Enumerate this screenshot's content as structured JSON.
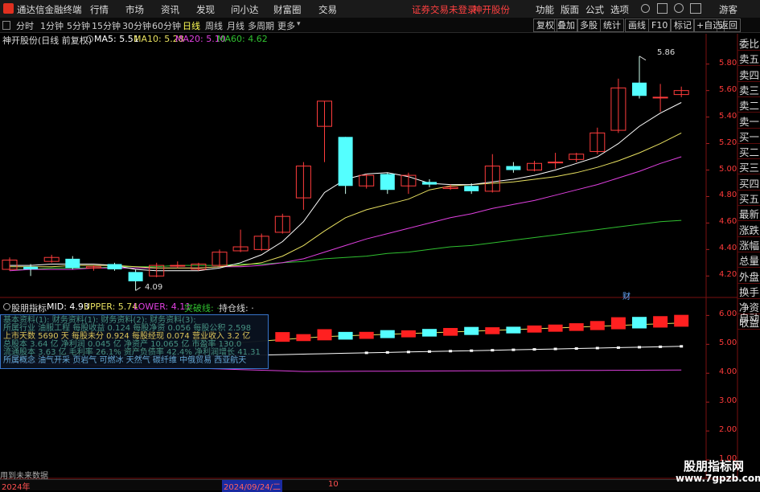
{
  "app": {
    "title": "通达信金融终端",
    "menus": [
      "行情",
      "市场",
      "资讯",
      "发现",
      "问小达",
      "财富圈",
      "交易"
    ],
    "alert": "证券交易未登录",
    "stock_name": "神开股份",
    "right_menus": [
      "功能",
      "版面",
      "公式",
      "选项"
    ],
    "guest": "游客"
  },
  "periods": [
    "分时",
    "1分钟",
    "5分钟",
    "15分钟",
    "30分钟",
    "60分钟",
    "日线",
    "周线",
    "月线",
    "多周期",
    "更多"
  ],
  "selected_period": "日线",
  "right_buttons": [
    "复权",
    "叠加",
    "多股",
    "统计",
    "画线",
    "F10",
    "标记",
    "+自选",
    "返回"
  ],
  "main_info": {
    "title": "神开股份(日线 前复权)",
    "ma5": "MA5: 5.51",
    "ma10": "MA10: 5.28",
    "ma20": "MA20: 5.10",
    "ma60": "MA60: 4.62"
  },
  "side_tabs": [
    "委比",
    "卖五",
    "卖四",
    "卖三",
    "卖二",
    "卖一",
    "买一",
    "买二",
    "买三",
    "买四",
    "买五",
    "最新",
    "涨跌",
    "涨幅",
    "总量",
    "外盘",
    "换手",
    "净资",
    "收益"
  ],
  "auto_label": "自动",
  "price_axis": [
    "5.80",
    "5.60",
    "5.40",
    "5.20",
    "5.00",
    "4.80",
    "4.60",
    "4.40",
    "4.20"
  ],
  "sub_axis": [
    "6.00",
    "5.00",
    "4.00",
    "3.00",
    "2.00",
    "1.00"
  ],
  "annotations": {
    "high": "5.86",
    "low": "4.09",
    "cai": "财"
  },
  "sub_info": {
    "name": "股朋指标",
    "mid": "MID: 4.93",
    "upper": "UPPER: 5.74",
    "lower": "LOWER: 4.11",
    "tupo": "突破线: ·",
    "chicang": "持仓线: ·"
  },
  "overlay_rows": [
    "基本资料(1):   财务资料(1):   财务资料(2):   财务资料(3):",
    "所属行业 油服工程   每股收益 0.124   每股净资 0.056   每股公积 2.598",
    "上市天数 5690 天   每股未分 0.924   每股经现 0.074   营业收入 3.2 亿",
    "总股本 3.64 亿   净利润 0.045 亿   净资产 10.065 亿   市盈率 130.0",
    "流通股本 3.63 亿   毛利率 26.1%   资产负债率 42.4%   净利润增长 41.31",
    "所属概念 油气开采 页岩气 可燃冰 天然气 碳纤维 中俄贸易 西亚航天"
  ],
  "bottom": {
    "left_text": "用到未来数据",
    "year": "2024年",
    "date": "2024/09/24/二",
    "tick": "10"
  },
  "watermark": {
    "cn": "股朋指标网",
    "url": "www.7gpzb.com"
  },
  "chart_data": {
    "type": "candlestick",
    "candles": [
      {
        "o": 4.25,
        "c": 4.32,
        "h": 4.34,
        "l": 4.24
      },
      {
        "o": 4.27,
        "c": 4.25,
        "h": 4.29,
        "l": 4.2
      },
      {
        "o": 4.31,
        "c": 4.34,
        "h": 4.36,
        "l": 4.3
      },
      {
        "o": 4.33,
        "c": 4.26,
        "h": 4.35,
        "l": 4.25
      },
      {
        "o": 4.26,
        "c": 4.27,
        "h": 4.28,
        "l": 4.24
      },
      {
        "o": 4.29,
        "c": 4.25,
        "h": 4.3,
        "l": 4.24
      },
      {
        "o": 4.23,
        "c": 4.16,
        "h": 4.25,
        "l": 4.09
      },
      {
        "o": 4.2,
        "c": 4.28,
        "h": 4.3,
        "l": 4.19
      },
      {
        "o": 4.28,
        "c": 4.28,
        "h": 4.31,
        "l": 4.26
      },
      {
        "o": 4.25,
        "c": 4.29,
        "h": 4.3,
        "l": 4.24
      },
      {
        "o": 4.28,
        "c": 4.38,
        "h": 4.4,
        "l": 4.27
      },
      {
        "o": 4.39,
        "c": 4.42,
        "h": 4.55,
        "l": 4.38
      },
      {
        "o": 4.4,
        "c": 4.5,
        "h": 4.52,
        "l": 4.39
      },
      {
        "o": 4.53,
        "c": 4.65,
        "h": 4.67,
        "l": 4.52
      },
      {
        "o": 4.79,
        "c": 5.03,
        "h": 5.06,
        "l": 4.7
      },
      {
        "o": 5.33,
        "c": 5.52,
        "h": 5.52,
        "l": 5.06
      },
      {
        "o": 5.25,
        "c": 4.88,
        "h": 5.25,
        "l": 4.82
      },
      {
        "o": 4.88,
        "c": 4.96,
        "h": 4.97,
        "l": 4.86
      },
      {
        "o": 4.97,
        "c": 4.85,
        "h": 4.98,
        "l": 4.82
      },
      {
        "o": 4.88,
        "c": 4.96,
        "h": 4.98,
        "l": 4.82
      },
      {
        "o": 4.91,
        "c": 4.89,
        "h": 4.93,
        "l": 4.87
      },
      {
        "o": 4.86,
        "c": 4.87,
        "h": 4.89,
        "l": 4.85
      },
      {
        "o": 4.88,
        "c": 4.84,
        "h": 4.9,
        "l": 4.82
      },
      {
        "o": 4.84,
        "c": 5.03,
        "h": 5.12,
        "l": 4.83
      },
      {
        "o": 5.03,
        "c": 5.0,
        "h": 5.06,
        "l": 4.98
      },
      {
        "o": 5.0,
        "c": 5.05,
        "h": 5.07,
        "l": 4.99
      },
      {
        "o": 5.06,
        "c": 5.06,
        "h": 5.13,
        "l": 5.01
      },
      {
        "o": 5.08,
        "c": 5.12,
        "h": 5.13,
        "l": 5.06
      },
      {
        "o": 5.14,
        "c": 5.28,
        "h": 5.32,
        "l": 5.12
      },
      {
        "o": 5.3,
        "c": 5.62,
        "h": 5.69,
        "l": 5.28
      },
      {
        "o": 5.66,
        "c": 5.56,
        "h": 5.86,
        "l": 5.54
      },
      {
        "o": 5.55,
        "c": 5.55,
        "h": 5.65,
        "l": 5.44
      },
      {
        "o": 5.57,
        "c": 5.6,
        "h": 5.63,
        "l": 5.55
      }
    ],
    "ma5": [
      4.28,
      4.28,
      4.29,
      4.29,
      4.29,
      4.28,
      4.25,
      4.24,
      4.24,
      4.24,
      4.26,
      4.3,
      4.36,
      4.46,
      4.61,
      4.83,
      4.93,
      4.97,
      4.98,
      4.95,
      4.9,
      4.89,
      4.89,
      4.91,
      4.93,
      4.96,
      5.0,
      5.05,
      5.1,
      5.2,
      5.33,
      5.43,
      5.51
    ],
    "ma10": [
      4.27,
      4.27,
      4.27,
      4.28,
      4.28,
      4.28,
      4.27,
      4.26,
      4.26,
      4.26,
      4.27,
      4.28,
      4.3,
      4.35,
      4.43,
      4.54,
      4.64,
      4.7,
      4.74,
      4.78,
      4.85,
      4.88,
      4.89,
      4.9,
      4.91,
      4.93,
      4.95,
      4.98,
      5.02,
      5.07,
      5.13,
      5.2,
      5.28
    ],
    "ma20": [
      4.24,
      4.25,
      4.25,
      4.25,
      4.26,
      4.26,
      4.26,
      4.26,
      4.26,
      4.26,
      4.27,
      4.27,
      4.28,
      4.3,
      4.33,
      4.38,
      4.43,
      4.48,
      4.52,
      4.56,
      4.6,
      4.64,
      4.67,
      4.71,
      4.74,
      4.77,
      4.81,
      4.85,
      4.89,
      4.94,
      4.99,
      5.05,
      5.1
    ],
    "ma60": [
      4.25,
      4.25,
      4.26,
      4.26,
      4.26,
      4.27,
      4.27,
      4.27,
      4.28,
      4.28,
      4.28,
      4.29,
      4.29,
      4.3,
      4.31,
      4.33,
      4.34,
      4.35,
      4.37,
      4.38,
      4.4,
      4.42,
      4.43,
      4.45,
      4.47,
      4.49,
      4.51,
      4.53,
      4.55,
      4.57,
      4.59,
      4.61,
      4.62
    ],
    "ylim": [
      4.05,
      5.95
    ],
    "sub_ylim": [
      0.5,
      6.4
    ],
    "sub_upper_start": 4.95,
    "sub_upper_end": 5.74,
    "sub_mid_start": 4.45,
    "sub_mid_end": 4.93,
    "sub_lower_start": 4.02,
    "sub_lower_end": 4.11,
    "colors": {
      "up": "#ff3c3c",
      "down": "#54ffff",
      "ma5": "#ffffff",
      "ma10": "#e8e060",
      "ma20": "#e040e0",
      "ma60": "#30c030"
    }
  }
}
